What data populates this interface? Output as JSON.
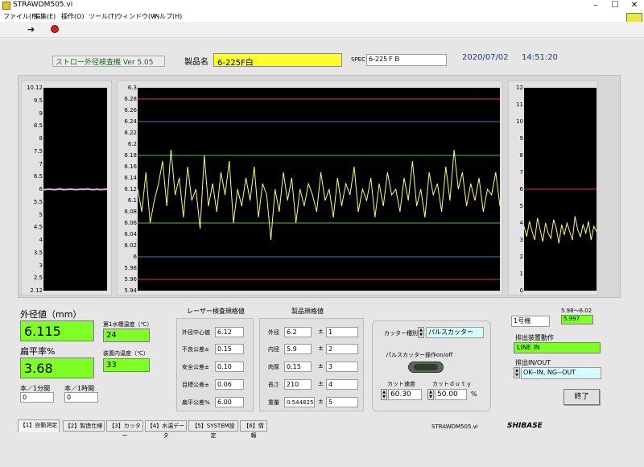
{
  "window": {
    "title": "STRAWDM505.vi"
  },
  "menu": [
    "ファイル(F)",
    "編集(E)",
    "操作(O)",
    "ツール(T)",
    "ウィンドウ(W)",
    "ヘルプ(H)"
  ],
  "header": {
    "app_label": "ストロー外径検査機  Ver 5.05",
    "product_label": "製品名",
    "product_value": "6-225F白",
    "spec_label": "SPEC",
    "spec_value": "6-225ＦＢ",
    "date": "2020/07/02",
    "time": "14:51:20"
  },
  "left_graph": {
    "ticks": [
      "10.12",
      "9.5",
      "9",
      "8.5",
      "8",
      "7.5",
      "7",
      "6.5",
      "6",
      "5.5",
      "5",
      "4.5",
      "4",
      "3.5",
      "3",
      "2.5",
      "2.12"
    ]
  },
  "center_graph": {
    "ticks": [
      "6.3",
      "6.28",
      "6.26",
      "6.24",
      "6.22",
      "6.2",
      "6.18",
      "6.16",
      "6.14",
      "6.12",
      "6.1",
      "6.08",
      "6.06",
      "6.04",
      "6.02",
      "6",
      "5.98",
      "5.96",
      "5.94"
    ]
  },
  "right_graph": {
    "ticks": [
      "12",
      "11",
      "10",
      "9",
      "8",
      "7",
      "6",
      "5",
      "4",
      "3",
      "2",
      "1",
      "0"
    ]
  },
  "chart_data": [
    {
      "type": "line",
      "title": "",
      "ylim": [
        2.12,
        10.12
      ],
      "series": [
        {
          "values": [
            6.1,
            6.11,
            6.12,
            6.1,
            6.11,
            6.13,
            6.1,
            6.11,
            6.12,
            6.11,
            6.1,
            6.12,
            6.11,
            6.13,
            6.11,
            6.1,
            6.12,
            6.1,
            6.11,
            6.12
          ]
        }
      ]
    },
    {
      "type": "line",
      "title": "",
      "ylim": [
        5.94,
        6.3
      ],
      "reference_lines": [
        6.28,
        6.24,
        6.18,
        6.06,
        6.0,
        5.96
      ],
      "series": [
        {
          "values": [
            6.12,
            6.08,
            6.15,
            6.06,
            6.1,
            6.13,
            6.17,
            6.09,
            6.19,
            6.11,
            6.14,
            6.07,
            6.16,
            6.1,
            6.12,
            6.05,
            6.18,
            6.09,
            6.13,
            6.08,
            6.15,
            6.11,
            6.17,
            6.06,
            6.12,
            6.09,
            6.14,
            6.1,
            6.16,
            6.07,
            6.13,
            6.11,
            6.03,
            6.12,
            6.08,
            6.15,
            6.1,
            6.14,
            6.06,
            6.12,
            6.09,
            6.13,
            6.11,
            6.08,
            6.15,
            6.1,
            6.12,
            6.07,
            6.14,
            6.09,
            6.13,
            6.11,
            6.16,
            6.08,
            6.12,
            6.1,
            6.14,
            6.07,
            6.13,
            6.09,
            6.15,
            6.11,
            6.12,
            6.08,
            6.14,
            6.1,
            6.17,
            6.09,
            6.12,
            6.07,
            6.15,
            6.11,
            6.13,
            6.08,
            6.16,
            6.1,
            6.19,
            6.12,
            6.15,
            6.09,
            6.13,
            6.1,
            6.14,
            6.08,
            6.12,
            6.11,
            6.15,
            6.09
          ]
        }
      ]
    },
    {
      "type": "line",
      "title": "",
      "ylim": [
        0,
        12
      ],
      "reference_lines": [
        6
      ],
      "series": [
        {
          "values": [
            3.8,
            3.2,
            4.1,
            3.5,
            3.0,
            4.3,
            3.6,
            2.9,
            4.0,
            3.4,
            3.1,
            4.2,
            3.7,
            2.8,
            3.9,
            3.3,
            4.0,
            3.5,
            3.0,
            4.4,
            3.6,
            3.2,
            3.9,
            3.4,
            4.1,
            3.0,
            3.8,
            3.5
          ]
        }
      ]
    }
  ],
  "measure": {
    "od_label": "外径値（mm）",
    "od_value": "6.115",
    "flat_label": "扁平率%",
    "flat_value": "3.68",
    "tank1_label": "第1水槽温度（℃）",
    "tank1_value": "24",
    "room_label": "装置内温度（℃）",
    "room_value": "33",
    "per_min_label": "本／1分間",
    "per_min_value": "0",
    "per_hour_label": "本／1時間",
    "per_hour_value": "0"
  },
  "laser": {
    "title": "レーザー検査規格値",
    "rows": [
      {
        "label": "外径中心値",
        "value": "6.12"
      },
      {
        "label": "不良公差±",
        "value": "0.15"
      },
      {
        "label": "安全公差±",
        "value": "0.10"
      },
      {
        "label": "目標公差±",
        "value": "0.06"
      },
      {
        "label": "扁平公差%",
        "value": "6.00"
      }
    ]
  },
  "product_spec": {
    "title": "製品規格値",
    "rows": [
      {
        "label": "外径",
        "value": "6.2",
        "tol": "1"
      },
      {
        "label": "内径",
        "value": "5.9",
        "tol": "2"
      },
      {
        "label": "肉厚",
        "value": "0.15",
        "tol": "3"
      },
      {
        "label": "長さ",
        "value": "210",
        "tol": "4"
      },
      {
        "label": "重量",
        "value": "0.544825",
        "tol": "5"
      }
    ]
  },
  "cutter": {
    "type_label": "カッター種別",
    "type_value": "パルスカッター",
    "onoff_label": "パルスカッター操作on/off",
    "speed_label": "カット速度",
    "speed_value": "60.30",
    "duty_label": "カットｄｕｔｙ",
    "duty_value": "50.00",
    "duty_unit": "%"
  },
  "status": {
    "machine": "1号機",
    "range": "5.98～6.02",
    "range_value": "5.997",
    "eject_label": "排出装置動作",
    "eject_value": "LINE IN",
    "inout_label": "排出IN/OUT",
    "inout_value": "OK--IN,  NG--OUT",
    "end_button": "終了"
  },
  "tabs": [
    "【1】自動測定",
    "【2】製造仕様",
    "【3】カッター",
    "【4】水温データ",
    "【5】SYSTEM設定",
    "【6】情報"
  ],
  "footer": {
    "vi_name": "STRAWDM505.vi",
    "brand": "SHIBASE"
  },
  "colors": {
    "trace": "#ffff66",
    "green": "#7fff26",
    "yellow_field": "#ffff26",
    "cyan_field": "#d6fbff"
  }
}
